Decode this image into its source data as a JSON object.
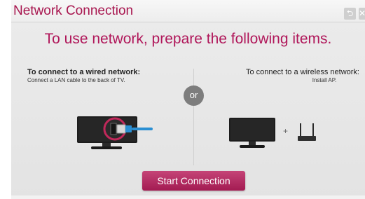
{
  "window": {
    "title": "Network Connection"
  },
  "titlebar_buttons": [
    {
      "icon": "back-arrow-icon",
      "glyph": "⮌"
    },
    {
      "icon": "close-icon",
      "glyph": "✕"
    }
  ],
  "headline": "To use network, prepare the following items.",
  "wired": {
    "heading": "To connect to a wired network:",
    "instruction": "Connect a LAN cable to the back of TV."
  },
  "divider_label": "or",
  "wireless": {
    "heading": "To connect to a wireless network:",
    "instruction": "Install AP."
  },
  "plus_sign": "+",
  "start_button": {
    "label": "Start Connection"
  },
  "colors": {
    "title": "#a8164f",
    "headline": "#b0175a",
    "button": "#b42a63",
    "cable": "#2a8fd3",
    "or_circle": "#7d7d7d"
  }
}
